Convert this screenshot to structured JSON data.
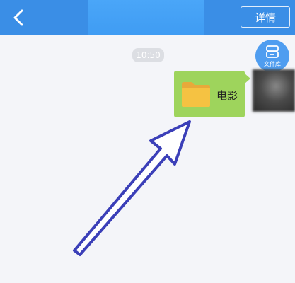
{
  "header": {
    "title": "",
    "details_label": "详情"
  },
  "chat": {
    "timestamp": "10:50",
    "file_library_label": "文件库",
    "message": {
      "file_name": "电影",
      "bubble_color": "#9ed45c"
    }
  },
  "colors": {
    "header_bg": "#3a8ee6",
    "page_bg": "#f4f5f9",
    "annotation_arrow": "#3b3fb8",
    "folder": "#f5c242"
  }
}
